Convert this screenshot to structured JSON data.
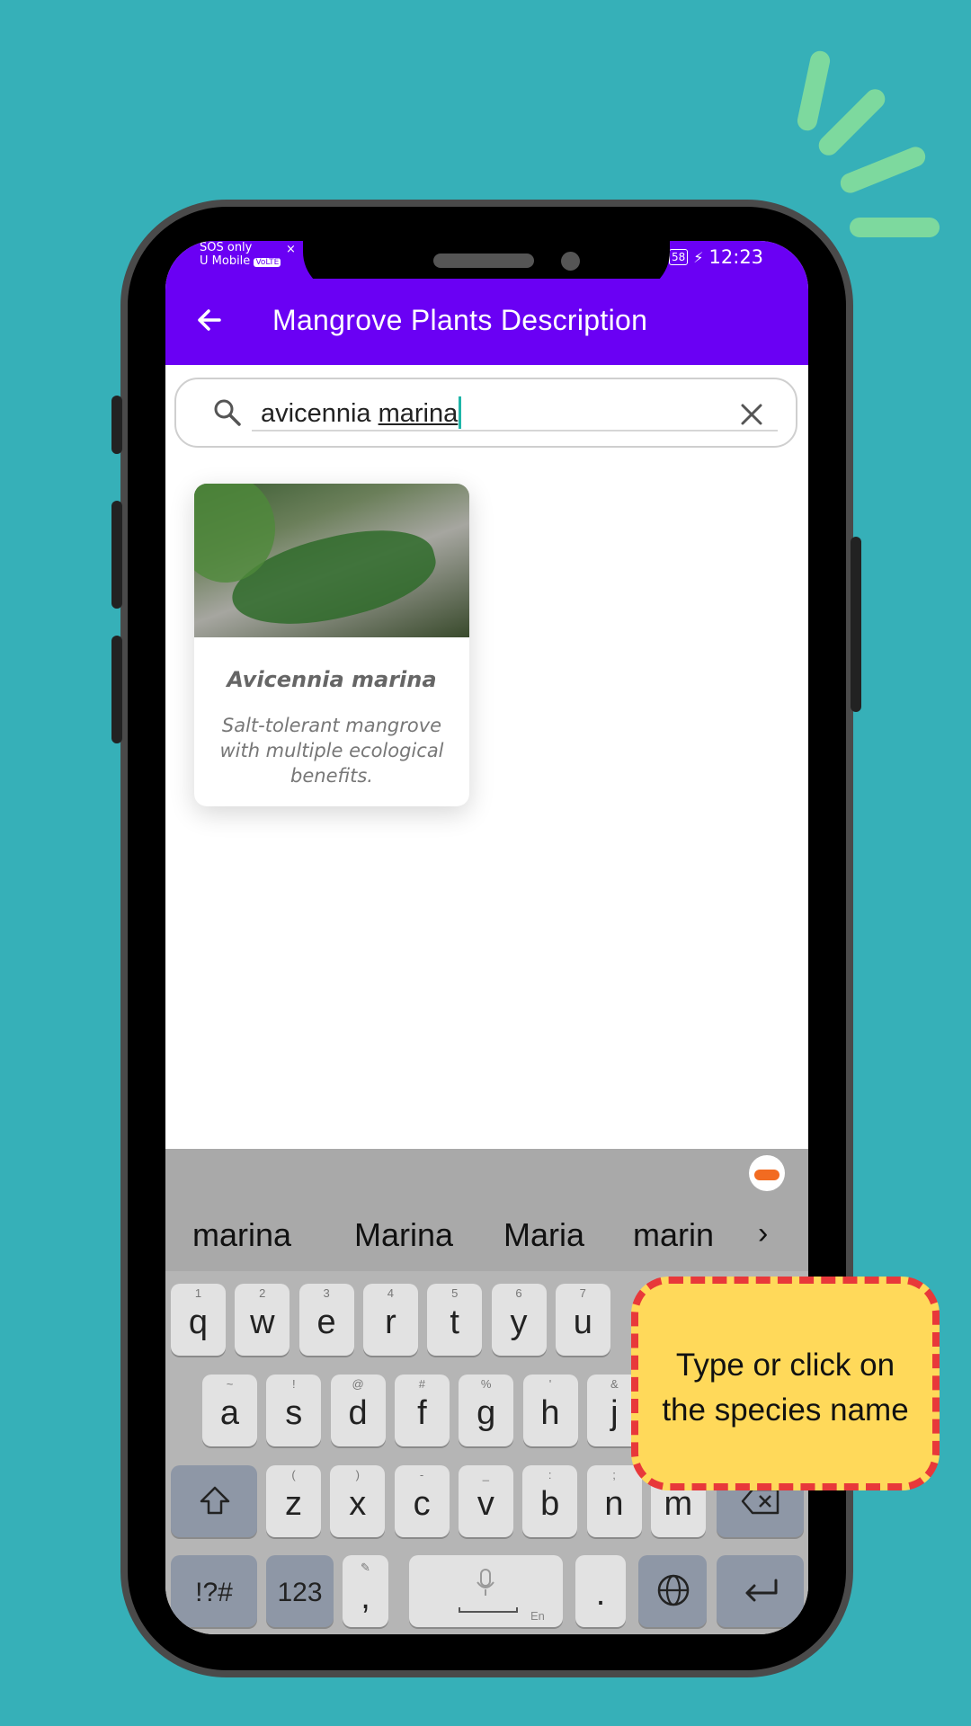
{
  "status": {
    "carrier_line1": "SOS only",
    "carrier_line2": "U Mobile",
    "volte": "VoLTE",
    "battery": "58",
    "time": "12:23"
  },
  "appbar": {
    "title": "Mangrove Plants Description"
  },
  "search": {
    "typed_prefix": "avicennia ",
    "composing_word": "marina"
  },
  "results": [
    {
      "name": "Avicennia marina",
      "description": "Salt-tolerant mangrove with multiple ecological benefits."
    }
  ],
  "keyboard": {
    "suggestions": [
      "marina",
      "Marina",
      "Maria",
      "marin"
    ],
    "row1": [
      {
        "key": "q",
        "hint": "1"
      },
      {
        "key": "w",
        "hint": "2"
      },
      {
        "key": "e",
        "hint": "3"
      },
      {
        "key": "r",
        "hint": "4"
      },
      {
        "key": "t",
        "hint": "5"
      },
      {
        "key": "y",
        "hint": "6"
      },
      {
        "key": "u",
        "hint": "7"
      }
    ],
    "row2": [
      {
        "key": "a",
        "hint": "~"
      },
      {
        "key": "s",
        "hint": "!"
      },
      {
        "key": "d",
        "hint": "@"
      },
      {
        "key": "f",
        "hint": "#"
      },
      {
        "key": "g",
        "hint": "%"
      },
      {
        "key": "h",
        "hint": "'"
      },
      {
        "key": "j",
        "hint": "&"
      }
    ],
    "row3": [
      {
        "key": "z",
        "hint": "("
      },
      {
        "key": "x",
        "hint": ")"
      },
      {
        "key": "c",
        "hint": "-"
      },
      {
        "key": "v",
        "hint": "_"
      },
      {
        "key": "b",
        "hint": ":"
      },
      {
        "key": "n",
        "hint": ";"
      },
      {
        "key": "m",
        "hint": "/"
      }
    ],
    "symbols_label": "!?#",
    "numbers_label": "123",
    "comma_label": ",",
    "period_label": ".",
    "language_label": "En"
  },
  "callout": {
    "line1": "Type or click on",
    "line2": "the species name"
  },
  "colors": {
    "background": "#36b0b8",
    "appbar": "#6a00f4",
    "callout_fill": "#ffd95a",
    "callout_border": "#e8383a",
    "spark": "#7dd99e"
  }
}
